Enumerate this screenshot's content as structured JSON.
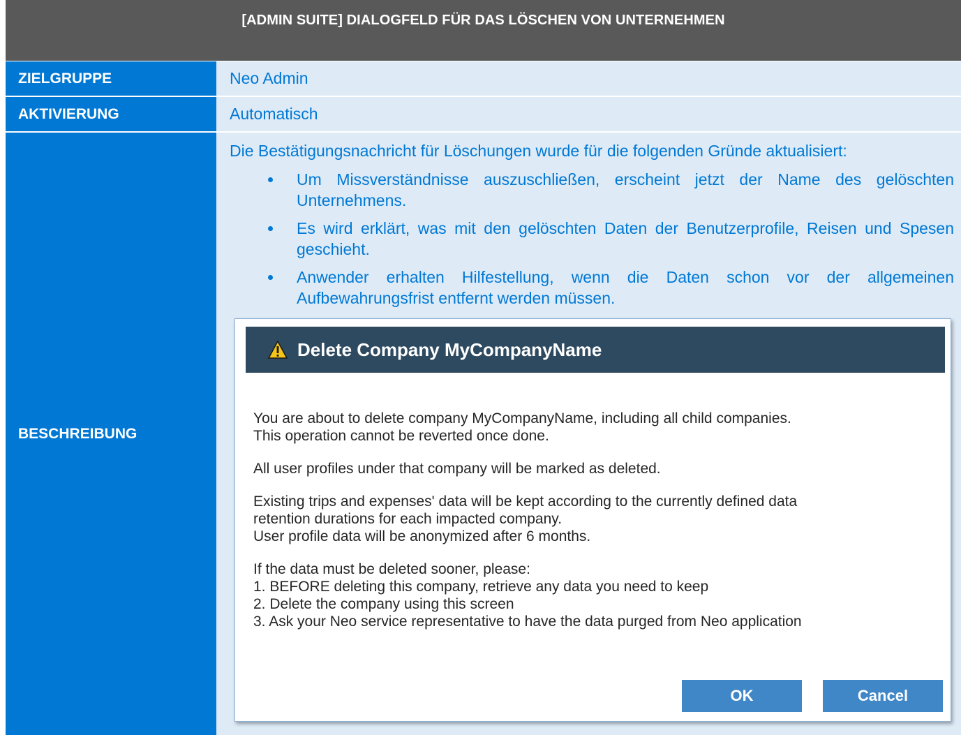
{
  "header": {
    "title": "[ADMIN SUITE] DIALOGFELD FÜR DAS LÖSCHEN VON UNTERNEHMEN"
  },
  "rows": {
    "zielgruppe": {
      "label": "ZIELGRUPPE",
      "value": "Neo Admin"
    },
    "aktivierung": {
      "label": "AKTIVIERUNG",
      "value": "Automatisch"
    },
    "beschreibung": {
      "label": "BESCHREIBUNG",
      "intro": "Die Bestätigungsnachricht für Löschungen wurde für die folgenden Gründe aktualisiert:",
      "bullets": [
        "Um Missverständnisse auszuschließen, erscheint jetzt der Name des gelöschten Unternehmens.",
        "Es wird erklärt, was mit den gelöschten Daten der Benutzerprofile, Reisen und Spesen geschieht.",
        "Anwender erhalten Hilfestellung, wenn die Daten schon vor der allgemeinen Aufbewahrungsfrist entfernt werden müssen."
      ]
    }
  },
  "dialog": {
    "title": "Delete Company MyCompanyName",
    "icon": "warning-icon",
    "paragraphs": [
      [
        "You are about to delete company MyCompanyName, including all child companies.",
        "This operation cannot be reverted once done."
      ],
      [
        "All user profiles under that company will be marked as deleted."
      ],
      [
        "Existing trips and expenses' data will be kept according to the currently defined data",
        "retention durations for each impacted company.",
        "User profile data will be anonymized after 6 months."
      ],
      [
        "If the data must be deleted sooner, please:",
        "1. BEFORE deleting this company, retrieve any data you need to keep",
        "2. Delete the company using this screen",
        "3. Ask your Neo service representative to have the data purged from Neo application"
      ]
    ],
    "ok_label": "OK",
    "cancel_label": "Cancel"
  },
  "colors": {
    "header_bg": "#595959",
    "label_bg": "#0078d4",
    "value_bg": "#deebf7",
    "dialog_title_bg": "#2e4a60",
    "button_bg": "#3f87c7"
  }
}
